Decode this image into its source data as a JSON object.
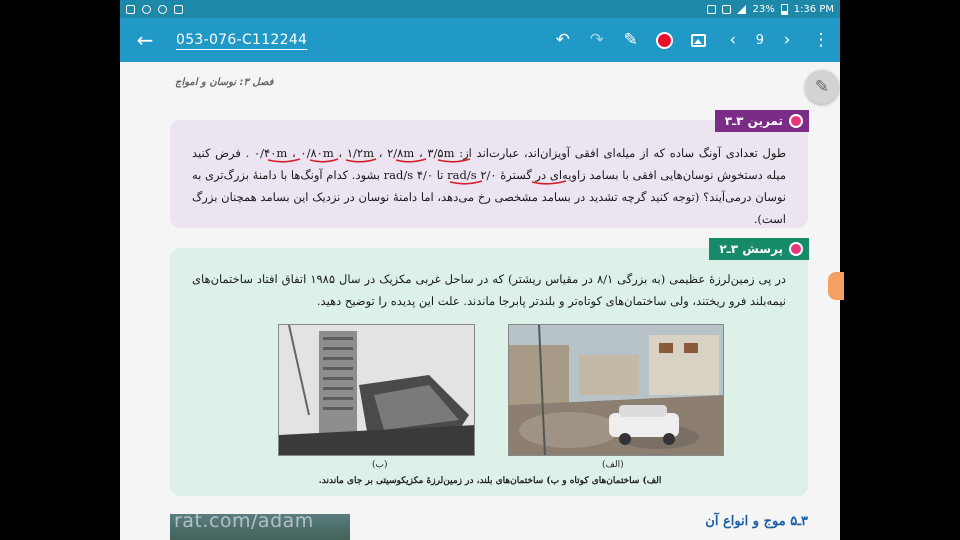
{
  "statusbar": {
    "battery": "23%",
    "time": "1:36 PM"
  },
  "toolbar": {
    "title": "053-076-C112244",
    "page": "9",
    "pen_color": "#e8102a"
  },
  "doc": {
    "chapter": "فصل ۳: نوسان و امواج",
    "exercise": {
      "tag": "تمرین ۳ـ۳",
      "text": "طول تعدادی آونگ ساده که از میله‌ای افقی آویزان‌اند، عبارت‌اند از: ۰/۴۰m ، ۰/۸۰m ، ۱/۲m ، ۲/۸m ، ۳/۵m . فرض کنید میله دستخوش نوسان‌هایی افقی با بسامد زاویه‌ای در گسترهٔ ۲/۰ rad/s تا ۴/۰ rad/s بشود. کدام آونگ‌ها با دامنهٔ بزرگ‌تری به نوسان درمی‌آیند؟ (توجه کنید گرچه تشدید در بسامد مشخصی رخ می‌دهد، اما دامنهٔ نوسان در نزدیک این بسامد همچنان بزرگ است)."
    },
    "question": {
      "tag": "پرسش ۳ـ۲",
      "text": "در پی زمین‌لرزهٔ عظیمی (به بزرگی ۸/۱ در مقیاس ریشتر) که در ساحل غربی مکزیک در سال ۱۹۸۵ اتفاق افتاد ساختمان‌های نیمه‌بلند فرو ریختند، ولی ساختمان‌های کوتاه‌تر و بلندتر پابرجا ماندند. علت این پدیده را توضیح دهید.",
      "caption_a": "(الف)",
      "caption_b": "(ب)",
      "figure_caption": "الف) ساختمان‌های کوتاه و ب) ساختمان‌های بلند، در زمین‌لرزهٔ مکزیکوسیتی بر جای ماندند."
    },
    "section_title": "۳ـ۵ موج و انواع آن",
    "watermark": "rat.com/adam"
  }
}
